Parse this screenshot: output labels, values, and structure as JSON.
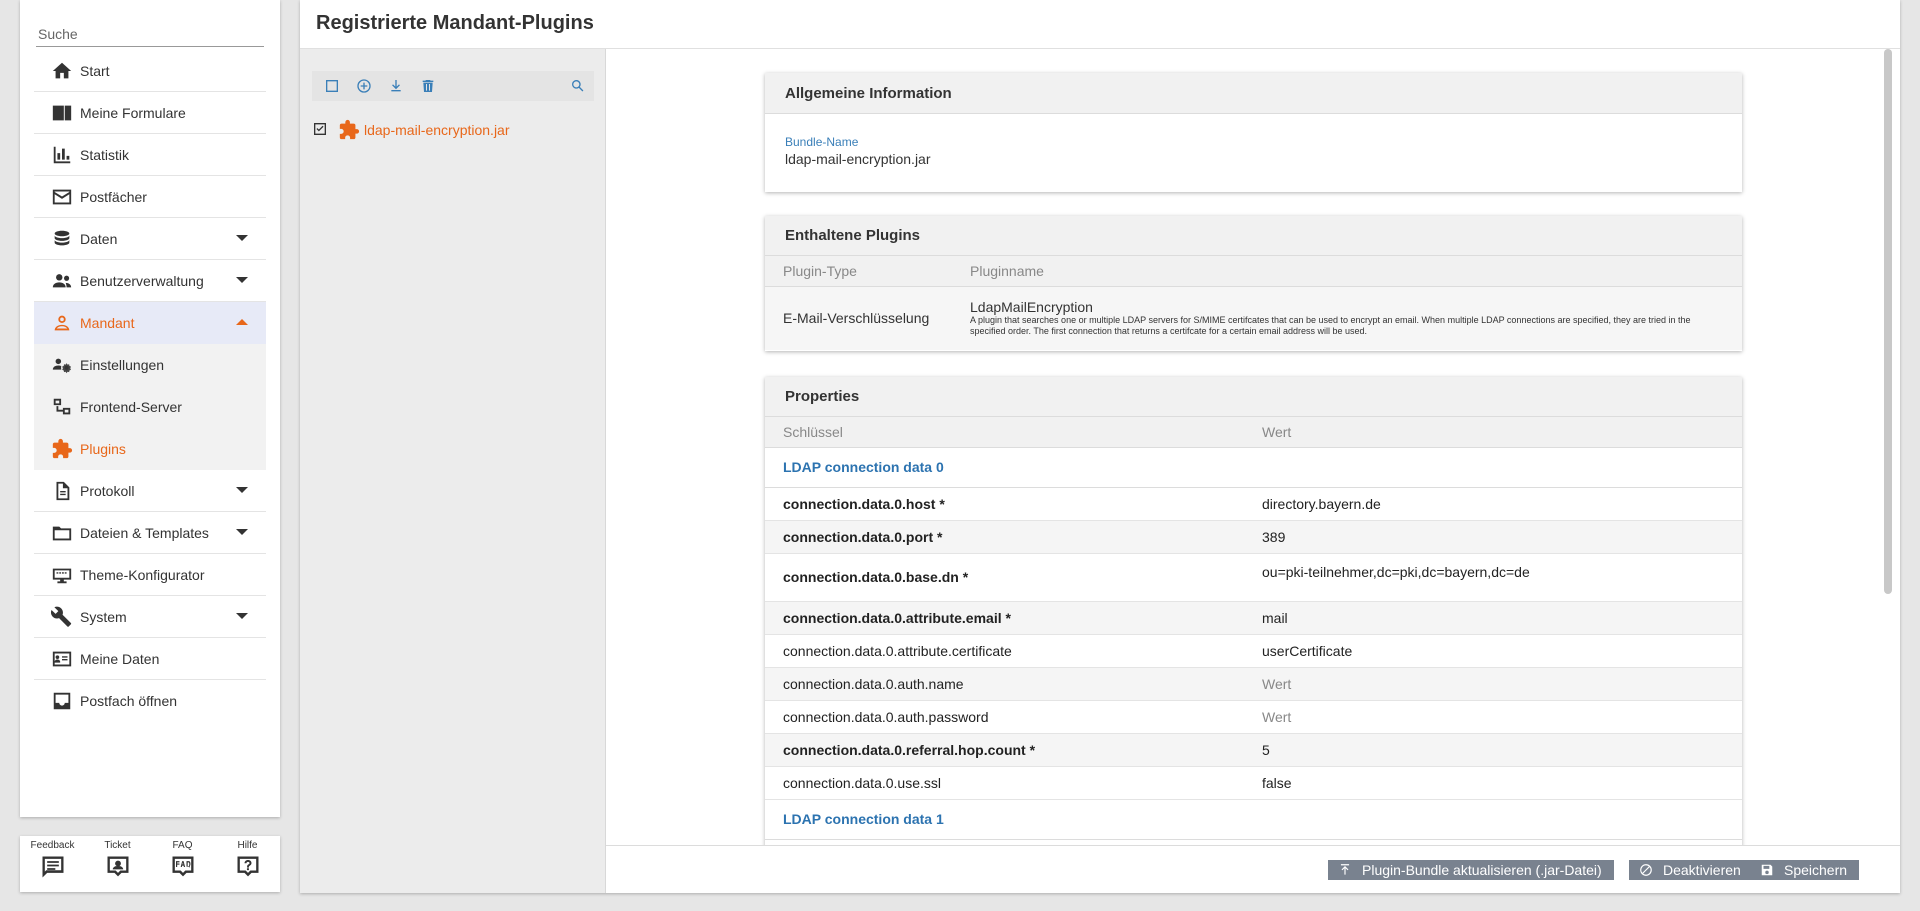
{
  "sidebar": {
    "search_placeholder": "Suche",
    "items": [
      {
        "label": "Start"
      },
      {
        "label": "Meine Formulare"
      },
      {
        "label": "Statistik"
      },
      {
        "label": "Postfächer"
      },
      {
        "label": "Daten"
      },
      {
        "label": "Benutzerverwaltung"
      },
      {
        "label": "Mandant"
      },
      {
        "label": "Einstellungen"
      },
      {
        "label": "Frontend-Server"
      },
      {
        "label": "Plugins"
      },
      {
        "label": "Protokoll"
      },
      {
        "label": "Dateien & Templates"
      },
      {
        "label": "Theme-Konfigurator"
      },
      {
        "label": "System"
      },
      {
        "label": "Meine Daten"
      },
      {
        "label": "Postfach öffnen"
      }
    ],
    "help": [
      {
        "label": "Feedback"
      },
      {
        "label": "Ticket"
      },
      {
        "label": "FAQ"
      },
      {
        "label": "Hilfe"
      }
    ]
  },
  "main": {
    "title": "Registrierte Mandant-Plugins",
    "list": {
      "items": [
        {
          "label": "ldap-mail-encryption.jar"
        }
      ]
    },
    "general": {
      "title": "Allgemeine Information",
      "bundle_label": "Bundle-Name",
      "bundle_value": "ldap-mail-encryption.jar"
    },
    "plugins": {
      "title": "Enthaltene Plugins",
      "col_type": "Plugin-Type",
      "col_name": "Pluginname",
      "type": "E-Mail-Verschlüsselung",
      "name": "LdapMailEncryption",
      "description": "A plugin that searches one or multiple LDAP servers for S/MIME certifcates that can be used to encrypt an email. When multiple LDAP connections are specified, they are tried in the specified order. The first connection that returns a certifcate for a certain email address will be used."
    },
    "properties": {
      "title": "Properties",
      "col_key": "Schlüssel",
      "col_value": "Wert",
      "group0": "LDAP connection data 0",
      "rows": [
        {
          "key": "connection.data.0.host *",
          "value": "directory.bayern.de"
        },
        {
          "key": "connection.data.0.port *",
          "value": "389"
        },
        {
          "key": "connection.data.0.base.dn *",
          "value": "ou=pki-teilnehmer,dc=pki,dc=bayern,dc=de"
        },
        {
          "key": "connection.data.0.attribute.email *",
          "value": "mail"
        },
        {
          "key": "connection.data.0.attribute.certificate",
          "value": "userCertificate"
        },
        {
          "key": "connection.data.0.auth.name",
          "value": "Wert"
        },
        {
          "key": "connection.data.0.auth.password",
          "value": "Wert"
        },
        {
          "key": "connection.data.0.referral.hop.count *",
          "value": "5"
        },
        {
          "key": "connection.data.0.use.ssl",
          "value": "false"
        }
      ],
      "group1": "LDAP connection data 1"
    },
    "footer": {
      "update_label": "Plugin-Bundle aktualisieren (.jar-Datei)",
      "deactivate_label": "Deaktivieren",
      "save_label": "Speichern"
    }
  },
  "colors": {
    "accent": "#e8671a",
    "link": "#2c73b0",
    "button": "#79828f"
  }
}
